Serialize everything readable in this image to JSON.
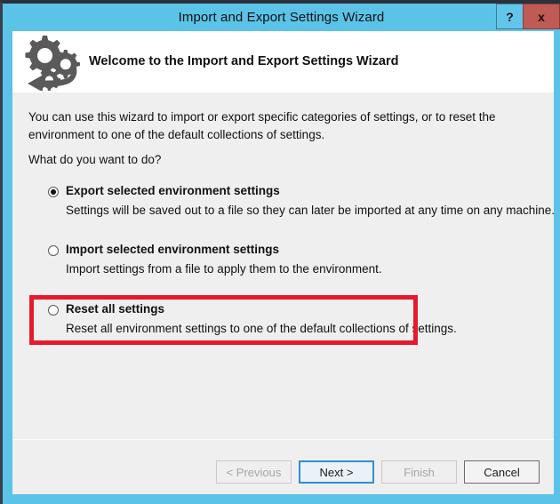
{
  "window": {
    "title": "Import and Export Settings Wizard",
    "frame_color": "#5bc3e8",
    "help_label": "?",
    "close_label": "x"
  },
  "header": {
    "icon": "gears-refresh-icon",
    "heading": "Welcome to the Import and Export Settings Wizard"
  },
  "body": {
    "intro": "You can use this wizard to import or export specific categories of settings, or to reset the environment to one of the default collections of settings.",
    "question": "What do you want to do?",
    "options": [
      {
        "label": "Export selected environment settings",
        "description": "Settings will be saved out to a file so they can later be imported at any time on any machine.",
        "selected": true,
        "highlighted": false
      },
      {
        "label": "Import selected environment settings",
        "description": "Import settings from a file to apply them to the environment.",
        "selected": false,
        "highlighted": false
      },
      {
        "label": "Reset all settings",
        "description": "Reset all environment settings to one of the default collections of settings.",
        "selected": false,
        "highlighted": true
      }
    ],
    "highlight_color": "#e8192c"
  },
  "footer": {
    "buttons": [
      {
        "label": "< Previous",
        "state": "disabled"
      },
      {
        "label": "Next >",
        "state": "default"
      },
      {
        "label": "Finish",
        "state": "disabled"
      },
      {
        "label": "Cancel",
        "state": "normal"
      }
    ]
  }
}
